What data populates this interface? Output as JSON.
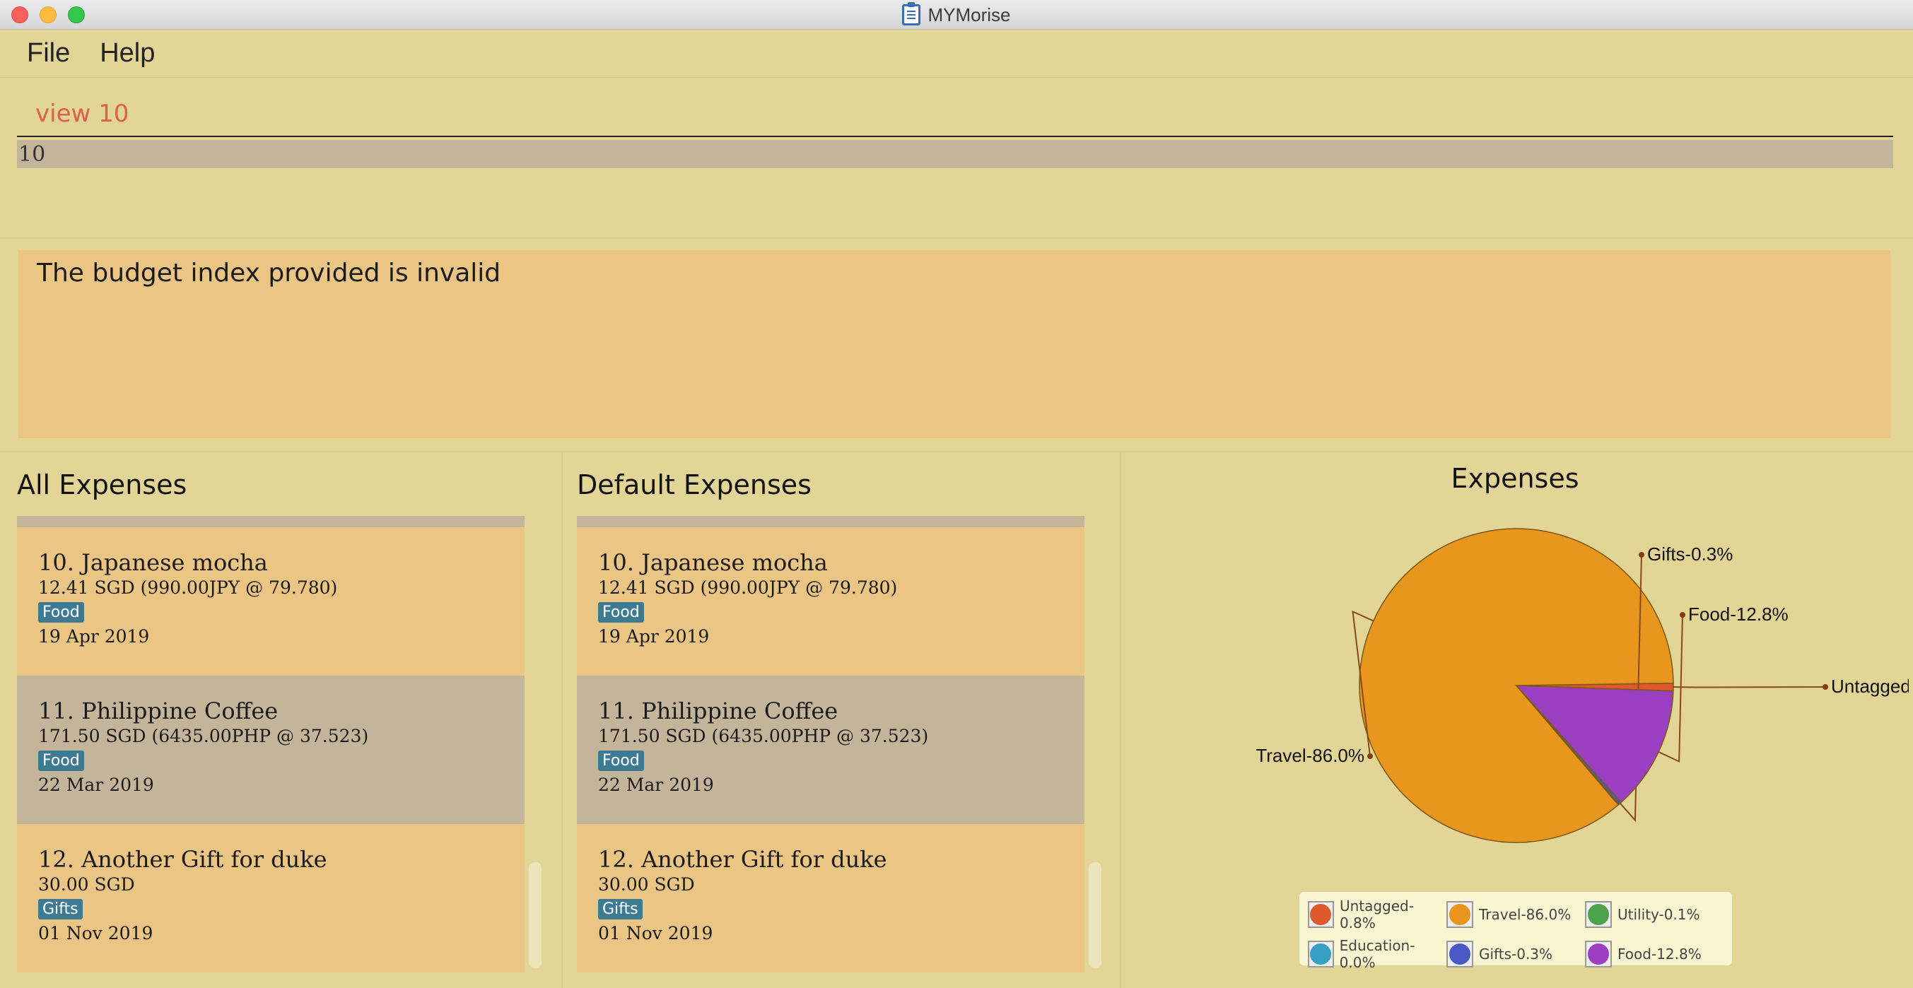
{
  "window": {
    "title": "MYMorise"
  },
  "menu": {
    "file": "File",
    "help": "Help"
  },
  "command": {
    "input": "view 10",
    "suggestion": "10"
  },
  "result": {
    "message": "The budget index provided is invalid"
  },
  "all_expenses": {
    "title": "All Expenses",
    "items": [
      {
        "title": "10.  Japanese mocha",
        "amount": "12.41 SGD (990.00JPY @ 79.780)",
        "tag": "Food",
        "date": "19 Apr 2019"
      },
      {
        "title": "11.  Philippine Coffee",
        "amount": "171.50 SGD (6435.00PHP @ 37.523)",
        "tag": "Food",
        "date": "22 Mar 2019"
      },
      {
        "title": "12.  Another Gift for duke",
        "amount": "30.00 SGD",
        "tag": "Gifts",
        "date": "01 Nov 2019"
      }
    ]
  },
  "default_expenses": {
    "title": "Default Expenses",
    "items": [
      {
        "title": "10.  Japanese mocha",
        "amount": "12.41 SGD (990.00JPY @ 79.780)",
        "tag": "Food",
        "date": "19 Apr 2019"
      },
      {
        "title": "11.  Philippine Coffee",
        "amount": "171.50 SGD (6435.00PHP @ 37.523)",
        "tag": "Food",
        "date": "22 Mar 2019"
      },
      {
        "title": "12.  Another Gift for duke",
        "amount": "30.00 SGD",
        "tag": "Gifts",
        "date": "01 Nov 2019"
      }
    ]
  },
  "chart_data": {
    "type": "pie",
    "title": "Expenses",
    "slices": [
      {
        "label": "Untagged-0.8%",
        "value": 0.8,
        "color": "#e0582e"
      },
      {
        "label": "Travel-86.0%",
        "value": 86.0,
        "color": "#e8961e"
      },
      {
        "label": "Utility-0.1%",
        "value": 0.1,
        "color": "#4aa34a"
      },
      {
        "label": "Education-0.0%",
        "value": 0.0,
        "color": "#3a9fc4"
      },
      {
        "label": "Gifts-0.3%",
        "value": 0.3,
        "color": "#4a59c4"
      },
      {
        "label": "Food-12.8%",
        "value": 12.8,
        "color": "#9a3fc2"
      }
    ],
    "legend_position": "bottom"
  }
}
